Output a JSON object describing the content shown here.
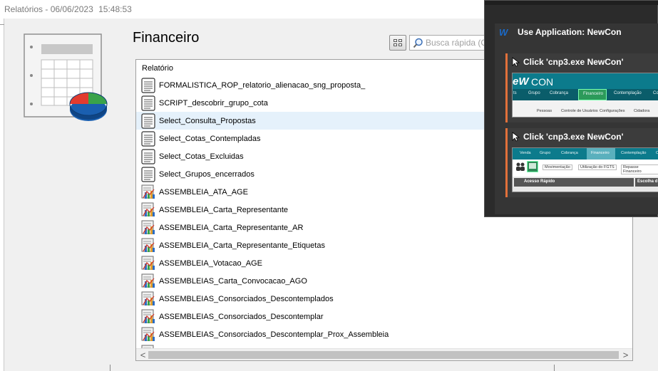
{
  "window": {
    "title": "Relatórios - 06/06/2023",
    "time": "15:48:53"
  },
  "main": {
    "page_title": "Financeiro",
    "search": {
      "placeholder": "Busca rápida (Ct"
    },
    "list": {
      "column_header": "Relatório",
      "items": [
        {
          "label": "FORMALISTICA_ROP_relatorio_alienacao_sng_proposta_",
          "icon": "text-document-icon"
        },
        {
          "label": "SCRIPT_descobrir_grupo_cota",
          "icon": "text-document-icon"
        },
        {
          "label": "Select_Consulta_Propostas",
          "icon": "text-document-icon",
          "selected": true
        },
        {
          "label": "Select_Cotas_Contempladas",
          "icon": "text-document-icon"
        },
        {
          "label": "Select_Cotas_Excluidas",
          "icon": "text-document-icon"
        },
        {
          "label": "Select_Grupos_encerrados",
          "icon": "text-document-icon"
        },
        {
          "label": "ASSEMBLEIA_ATA_AGE",
          "icon": "chart-report-icon"
        },
        {
          "label": "ASSEMBLEIA_Carta_Representante",
          "icon": "chart-report-icon"
        },
        {
          "label": "ASSEMBLEIA_Carta_Representante_AR",
          "icon": "chart-report-icon"
        },
        {
          "label": "ASSEMBLEIA_Carta_Representante_Etiquetas",
          "icon": "chart-report-icon"
        },
        {
          "label": "ASSEMBLEIA_Votacao_AGE",
          "icon": "chart-report-icon"
        },
        {
          "label": "ASSEMBLEIAS_Carta_Convocacao_AGO",
          "icon": "chart-report-icon"
        },
        {
          "label": "ASSEMBLEIAS_Consorciados_Descontemplados",
          "icon": "chart-report-icon"
        },
        {
          "label": "ASSEMBLEIAS_Consorciados_Descontemplar",
          "icon": "chart-report-icon"
        },
        {
          "label": "ASSEMBLEIAS_Consorciados_Descontemplar_Prox_Assembleia",
          "icon": "chart-report-icon"
        },
        {
          "label": "",
          "icon": "chart-report-icon"
        }
      ]
    },
    "scrollbar": {
      "left_arrow": "<",
      "right_arrow": ">"
    }
  },
  "overlay": {
    "app_step": "Use Application: NewCon",
    "click_steps": [
      {
        "label": "Click 'cnp3.exe NewCon'",
        "thumb_a": {
          "logo": "eW",
          "brand": "CON",
          "nav": [
            "ts",
            "Grupo",
            "Cobrança",
            "Financeiro",
            "Contemplação",
            "Co"
          ],
          "sub": [
            "Pessoas",
            "Controle de Usuários",
            "Configurações",
            "Cidadora"
          ]
        }
      },
      {
        "label": "Click 'cnp3.exe NewCon'",
        "thumb_b": {
          "nav": [
            "Venda",
            "Grupo",
            "Cobrança",
            "Financeiro",
            "Contemplação",
            "C"
          ],
          "sub": [
            "Movimentação",
            "Utilização do FGTS",
            "Repasse Financeiro"
          ],
          "panel_left": "Acesso Rápido",
          "panel_right": "Escolha d"
        }
      }
    ]
  },
  "colors": {
    "accent_overlay": "#e2703a",
    "selected_row": "#e5f1fb",
    "newcon_teal": "#0c7b8c"
  }
}
